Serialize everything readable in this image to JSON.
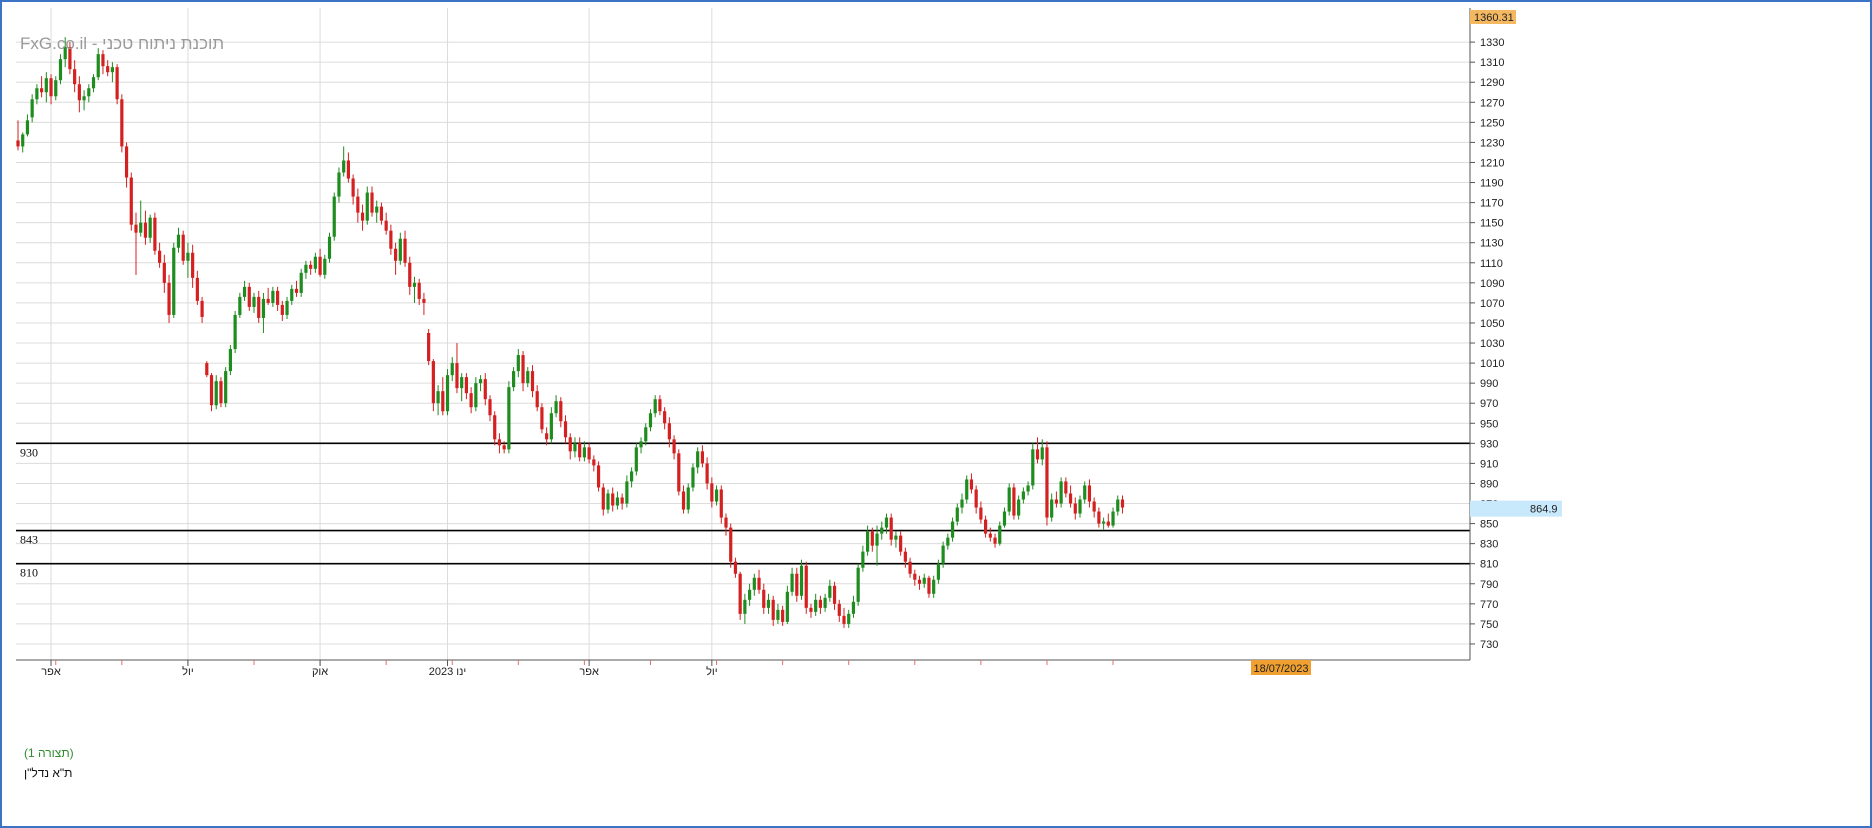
{
  "watermark": "FxG.co.il - תוכנת ניתוח טכני",
  "layout_label": "(תצורה 1)",
  "instrument": "ת\"א נדל\"ן",
  "colors": {
    "up": "#1e8c1e",
    "down": "#d42020",
    "grid": "#dcdcdc",
    "top_badge": "#f4b860",
    "price_badge": "#c8e8fb",
    "date_badge": "#f0a030",
    "frame": "#3d73c4"
  },
  "chart_data": {
    "type": "candlestick",
    "y_ticks": [
      1330,
      1310,
      1290,
      1270,
      1250,
      1230,
      1210,
      1190,
      1170,
      1150,
      1130,
      1110,
      1090,
      1070,
      1050,
      1030,
      1010,
      990,
      970,
      950,
      930,
      910,
      890,
      870,
      850,
      830,
      810,
      790,
      770,
      750,
      730
    ],
    "ylim": [
      714,
      1364
    ],
    "top_label": "1360.31",
    "last_price": "864.9",
    "crosshair_date": "18/07/2023",
    "x_labels": [
      {
        "label": "אפר",
        "index": 7
      },
      {
        "label": "יול",
        "index": 36
      },
      {
        "label": "אוק",
        "index": 64
      },
      {
        "label": "ינו 2023",
        "index": 91
      },
      {
        "label": "אפר",
        "index": 121
      },
      {
        "label": "יול",
        "index": 147
      }
    ],
    "levels": [
      {
        "label": "930",
        "value": 930
      },
      {
        "label": "843",
        "value": 843
      },
      {
        "label": "810",
        "value": 810
      }
    ],
    "candles": [
      [
        1232,
        1252,
        1222,
        1226
      ],
      [
        1226,
        1240,
        1220,
        1238
      ],
      [
        1238,
        1258,
        1236,
        1252
      ],
      [
        1255,
        1278,
        1250,
        1273
      ],
      [
        1273,
        1288,
        1268,
        1284
      ],
      [
        1284,
        1296,
        1275,
        1280
      ],
      [
        1280,
        1300,
        1270,
        1294
      ],
      [
        1294,
        1298,
        1268,
        1276
      ],
      [
        1276,
        1296,
        1272,
        1292
      ],
      [
        1292,
        1318,
        1288,
        1313
      ],
      [
        1313,
        1335,
        1305,
        1325
      ],
      [
        1325,
        1330,
        1298,
        1303
      ],
      [
        1303,
        1312,
        1280,
        1288
      ],
      [
        1288,
        1296,
        1260,
        1272
      ],
      [
        1272,
        1282,
        1262,
        1276
      ],
      [
        1276,
        1288,
        1270,
        1284
      ],
      [
        1284,
        1298,
        1280,
        1295
      ],
      [
        1295,
        1324,
        1292,
        1318
      ],
      [
        1318,
        1322,
        1298,
        1306
      ],
      [
        1306,
        1312,
        1296,
        1300
      ],
      [
        1300,
        1310,
        1290,
        1305
      ],
      [
        1305,
        1308,
        1268,
        1273
      ],
      [
        1273,
        1278,
        1220,
        1226
      ],
      [
        1226,
        1230,
        1185,
        1195
      ],
      [
        1195,
        1200,
        1142,
        1148
      ],
      [
        1148,
        1160,
        1098,
        1140
      ],
      [
        1140,
        1172,
        1136,
        1150
      ],
      [
        1150,
        1162,
        1128,
        1135
      ],
      [
        1135,
        1158,
        1130,
        1155
      ],
      [
        1155,
        1160,
        1118,
        1122
      ],
      [
        1122,
        1130,
        1105,
        1110
      ],
      [
        1110,
        1118,
        1080,
        1090
      ],
      [
        1090,
        1098,
        1050,
        1058
      ],
      [
        1058,
        1130,
        1055,
        1125
      ],
      [
        1125,
        1145,
        1120,
        1138
      ],
      [
        1138,
        1142,
        1108,
        1112
      ],
      [
        1112,
        1130,
        1095,
        1120
      ],
      [
        1120,
        1128,
        1085,
        1095
      ],
      [
        1095,
        1102,
        1068,
        1072
      ],
      [
        1072,
        1076,
        1050,
        1056
      ],
      [
        1010,
        1012,
        996,
        998
      ],
      [
        998,
        1000,
        962,
        968
      ],
      [
        968,
        998,
        964,
        992
      ],
      [
        992,
        996,
        966,
        970
      ],
      [
        970,
        1006,
        966,
        1002
      ],
      [
        1002,
        1028,
        998,
        1024
      ],
      [
        1024,
        1062,
        1020,
        1058
      ],
      [
        1058,
        1080,
        1055,
        1076
      ],
      [
        1076,
        1092,
        1072,
        1086
      ],
      [
        1086,
        1090,
        1062,
        1066
      ],
      [
        1066,
        1080,
        1060,
        1076
      ],
      [
        1076,
        1082,
        1050,
        1055
      ],
      [
        1055,
        1080,
        1040,
        1074
      ],
      [
        1074,
        1085,
        1068,
        1070
      ],
      [
        1070,
        1086,
        1066,
        1082
      ],
      [
        1082,
        1086,
        1062,
        1068
      ],
      [
        1068,
        1072,
        1052,
        1058
      ],
      [
        1058,
        1076,
        1054,
        1072
      ],
      [
        1072,
        1088,
        1068,
        1084
      ],
      [
        1084,
        1092,
        1076,
        1080
      ],
      [
        1080,
        1104,
        1076,
        1100
      ],
      [
        1100,
        1112,
        1094,
        1108
      ],
      [
        1108,
        1112,
        1098,
        1104
      ],
      [
        1104,
        1120,
        1100,
        1116
      ],
      [
        1116,
        1124,
        1096,
        1098
      ],
      [
        1098,
        1118,
        1094,
        1114
      ],
      [
        1114,
        1140,
        1110,
        1136
      ],
      [
        1136,
        1180,
        1132,
        1176
      ],
      [
        1176,
        1205,
        1170,
        1200
      ],
      [
        1200,
        1226,
        1196,
        1212
      ],
      [
        1212,
        1220,
        1190,
        1194
      ],
      [
        1194,
        1198,
        1168,
        1176
      ],
      [
        1176,
        1184,
        1150,
        1160
      ],
      [
        1160,
        1168,
        1142,
        1152
      ],
      [
        1152,
        1186,
        1148,
        1180
      ],
      [
        1180,
        1186,
        1156,
        1160
      ],
      [
        1160,
        1172,
        1150,
        1166
      ],
      [
        1166,
        1170,
        1148,
        1152
      ],
      [
        1152,
        1160,
        1138,
        1142
      ],
      [
        1142,
        1148,
        1118,
        1124
      ],
      [
        1124,
        1130,
        1098,
        1112
      ],
      [
        1112,
        1140,
        1108,
        1134
      ],
      [
        1134,
        1142,
        1106,
        1110
      ],
      [
        1110,
        1116,
        1078,
        1086
      ],
      [
        1086,
        1096,
        1070,
        1090
      ],
      [
        1090,
        1094,
        1068,
        1074
      ],
      [
        1074,
        1080,
        1058,
        1070
      ],
      [
        1040,
        1044,
        1008,
        1012
      ],
      [
        1012,
        1014,
        962,
        970
      ],
      [
        970,
        988,
        958,
        982
      ],
      [
        982,
        996,
        958,
        962
      ],
      [
        962,
        1004,
        958,
        998
      ],
      [
        998,
        1016,
        992,
        1010
      ],
      [
        1010,
        1030,
        980,
        985
      ],
      [
        985,
        1000,
        972,
        996
      ],
      [
        996,
        1000,
        974,
        980
      ],
      [
        980,
        986,
        960,
        966
      ],
      [
        966,
        996,
        962,
        990
      ],
      [
        990,
        998,
        982,
        994
      ],
      [
        994,
        1000,
        968,
        974
      ],
      [
        974,
        978,
        952,
        958
      ],
      [
        958,
        962,
        928,
        934
      ],
      [
        934,
        940,
        920,
        928
      ],
      [
        928,
        932,
        920,
        924
      ],
      [
        924,
        992,
        920,
        986
      ],
      [
        986,
        1006,
        982,
        1002
      ],
      [
        1002,
        1024,
        996,
        1018
      ],
      [
        1018,
        1022,
        982,
        990
      ],
      [
        990,
        1006,
        986,
        1002
      ],
      [
        1002,
        1008,
        976,
        982
      ],
      [
        982,
        988,
        962,
        966
      ],
      [
        966,
        970,
        940,
        944
      ],
      [
        940,
        946,
        928,
        934
      ],
      [
        934,
        966,
        930,
        960
      ],
      [
        960,
        978,
        956,
        972
      ],
      [
        972,
        976,
        946,
        952
      ],
      [
        952,
        958,
        930,
        936
      ],
      [
        936,
        940,
        914,
        922
      ],
      [
        922,
        936,
        916,
        930
      ],
      [
        930,
        936,
        912,
        916
      ],
      [
        916,
        932,
        912,
        926
      ],
      [
        926,
        930,
        910,
        914
      ],
      [
        914,
        918,
        902,
        908
      ],
      [
        908,
        912,
        882,
        886
      ],
      [
        886,
        890,
        858,
        864
      ],
      [
        864,
        884,
        860,
        880
      ],
      [
        880,
        886,
        862,
        868
      ],
      [
        868,
        882,
        864,
        876
      ],
      [
        876,
        880,
        864,
        870
      ],
      [
        870,
        898,
        866,
        892
      ],
      [
        892,
        906,
        886,
        902
      ],
      [
        902,
        930,
        898,
        926
      ],
      [
        926,
        936,
        920,
        932
      ],
      [
        932,
        950,
        928,
        946
      ],
      [
        946,
        964,
        942,
        960
      ],
      [
        960,
        978,
        956,
        974
      ],
      [
        974,
        978,
        958,
        962
      ],
      [
        962,
        966,
        944,
        950
      ],
      [
        950,
        956,
        926,
        934
      ],
      [
        934,
        938,
        914,
        920
      ],
      [
        920,
        924,
        878,
        882
      ],
      [
        882,
        888,
        860,
        864
      ],
      [
        864,
        890,
        860,
        886
      ],
      [
        886,
        910,
        882,
        906
      ],
      [
        906,
        926,
        900,
        922
      ],
      [
        922,
        928,
        906,
        910
      ],
      [
        910,
        916,
        884,
        890
      ],
      [
        890,
        896,
        866,
        872
      ],
      [
        872,
        888,
        868,
        884
      ],
      [
        884,
        888,
        850,
        856
      ],
      [
        856,
        860,
        838,
        846
      ],
      [
        846,
        850,
        806,
        812
      ],
      [
        812,
        816,
        796,
        800
      ],
      [
        800,
        802,
        754,
        760
      ],
      [
        760,
        780,
        750,
        774
      ],
      [
        774,
        790,
        768,
        784
      ],
      [
        784,
        800,
        778,
        796
      ],
      [
        796,
        804,
        780,
        784
      ],
      [
        784,
        790,
        760,
        766
      ],
      [
        766,
        780,
        760,
        774
      ],
      [
        774,
        778,
        748,
        754
      ],
      [
        754,
        770,
        750,
        764
      ],
      [
        764,
        768,
        748,
        752
      ],
      [
        752,
        788,
        750,
        782
      ],
      [
        782,
        806,
        778,
        800
      ],
      [
        800,
        806,
        772,
        778
      ],
      [
        778,
        814,
        774,
        808
      ],
      [
        808,
        812,
        760,
        766
      ],
      [
        766,
        770,
        756,
        762
      ],
      [
        762,
        780,
        758,
        774
      ],
      [
        774,
        778,
        760,
        766
      ],
      [
        766,
        780,
        762,
        776
      ],
      [
        776,
        794,
        772,
        788
      ],
      [
        788,
        792,
        764,
        770
      ],
      [
        770,
        774,
        752,
        758
      ],
      [
        758,
        766,
        746,
        750
      ],
      [
        750,
        764,
        746,
        760
      ],
      [
        760,
        778,
        756,
        772
      ],
      [
        772,
        810,
        768,
        806
      ],
      [
        806,
        828,
        802,
        822
      ],
      [
        822,
        848,
        818,
        842
      ],
      [
        842,
        846,
        822,
        828
      ],
      [
        828,
        848,
        808,
        840
      ],
      [
        840,
        852,
        834,
        846
      ],
      [
        846,
        860,
        840,
        856
      ],
      [
        856,
        860,
        828,
        834
      ],
      [
        834,
        842,
        826,
        838
      ],
      [
        838,
        842,
        818,
        822
      ],
      [
        822,
        826,
        806,
        812
      ],
      [
        812,
        816,
        796,
        800
      ],
      [
        800,
        804,
        788,
        794
      ],
      [
        794,
        798,
        784,
        790
      ],
      [
        790,
        800,
        786,
        796
      ],
      [
        796,
        798,
        776,
        780
      ],
      [
        780,
        798,
        776,
        794
      ],
      [
        794,
        814,
        790,
        810
      ],
      [
        810,
        832,
        806,
        828
      ],
      [
        828,
        840,
        824,
        836
      ],
      [
        836,
        856,
        832,
        852
      ],
      [
        852,
        870,
        848,
        866
      ],
      [
        866,
        880,
        860,
        874
      ],
      [
        874,
        898,
        870,
        894
      ],
      [
        894,
        900,
        880,
        884
      ],
      [
        884,
        888,
        860,
        866
      ],
      [
        866,
        872,
        850,
        854
      ],
      [
        854,
        858,
        836,
        840
      ],
      [
        840,
        846,
        832,
        836
      ],
      [
        836,
        840,
        826,
        830
      ],
      [
        830,
        852,
        828,
        848
      ],
      [
        848,
        866,
        846,
        862
      ],
      [
        862,
        890,
        858,
        886
      ],
      [
        886,
        890,
        854,
        858
      ],
      [
        858,
        878,
        854,
        874
      ],
      [
        874,
        886,
        870,
        882
      ],
      [
        882,
        892,
        878,
        888
      ],
      [
        888,
        930,
        884,
        924
      ],
      [
        924,
        936,
        910,
        914
      ],
      [
        914,
        934,
        908,
        926
      ],
      [
        926,
        932,
        848,
        856
      ],
      [
        856,
        880,
        852,
        874
      ],
      [
        874,
        882,
        866,
        870
      ],
      [
        870,
        896,
        866,
        892
      ],
      [
        892,
        896,
        876,
        880
      ],
      [
        880,
        888,
        866,
        870
      ],
      [
        870,
        876,
        854,
        860
      ],
      [
        860,
        878,
        856,
        874
      ],
      [
        874,
        892,
        870,
        888
      ],
      [
        888,
        894,
        866,
        872
      ],
      [
        872,
        876,
        856,
        862
      ],
      [
        862,
        866,
        846,
        850
      ],
      [
        850,
        856,
        844,
        852
      ],
      [
        852,
        860,
        846,
        848
      ],
      [
        848,
        866,
        846,
        862
      ],
      [
        862,
        878,
        858,
        874
      ],
      [
        874,
        878,
        860,
        866
      ]
    ]
  }
}
